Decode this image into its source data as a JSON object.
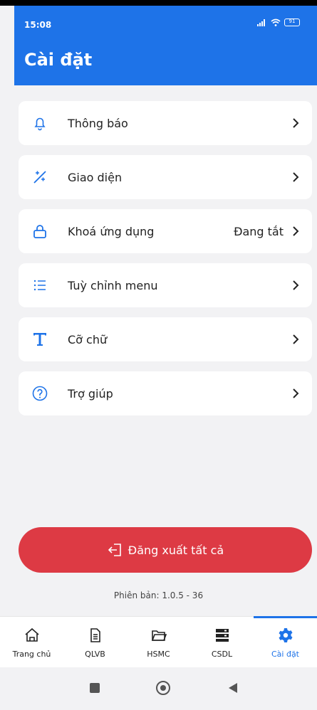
{
  "status_bar": {
    "time": "15:08",
    "battery": "91"
  },
  "header": {
    "title": "Cài đặt"
  },
  "settings": [
    {
      "label": "Thông báo",
      "value": "",
      "icon": "bell-icon"
    },
    {
      "label": "Giao diện",
      "value": "",
      "icon": "theme-icon"
    },
    {
      "label": "Khoá ứng dụng",
      "value": "Đang tắt",
      "icon": "lock-icon"
    },
    {
      "label": "Tuỳ chỉnh menu",
      "value": "",
      "icon": "list-icon"
    },
    {
      "label": "Cỡ chữ",
      "value": "",
      "icon": "font-size-icon"
    },
    {
      "label": "Trợ giúp",
      "value": "",
      "icon": "help-icon"
    }
  ],
  "logout": {
    "label": "Đăng xuất tất cả"
  },
  "version": "Phiên bản: 1.0.5 - 36",
  "tabs": [
    {
      "label": "Trang chủ",
      "icon": "home-icon",
      "active": false
    },
    {
      "label": "QLVB",
      "icon": "document-icon",
      "active": false
    },
    {
      "label": "HSMC",
      "icon": "folder-icon",
      "active": false
    },
    {
      "label": "CSDL",
      "icon": "database-icon",
      "active": false
    },
    {
      "label": "Cài đặt",
      "icon": "gear-icon",
      "active": true
    }
  ],
  "colors": {
    "primary": "#1e73e8",
    "danger": "#dd3a44",
    "background": "#f2f2f4"
  }
}
